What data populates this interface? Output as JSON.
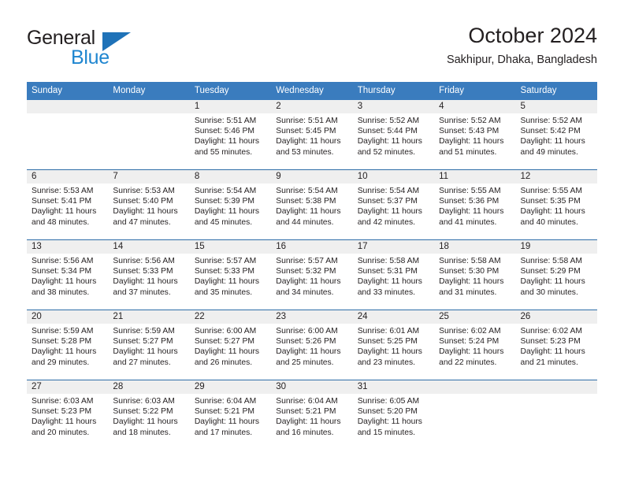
{
  "logo": {
    "word_top": "General",
    "word_bottom": "Blue",
    "triangle_color": "#1f72b8",
    "blue_color": "#1f86d0"
  },
  "header": {
    "title": "October 2024",
    "subtitle": "Sakhipur, Dhaka, Bangladesh"
  },
  "theme": {
    "header_blue": "#3a7cbe",
    "row_divider_blue": "#2e6da8",
    "daynum_band": "#efefef"
  },
  "weekdays": [
    "Sunday",
    "Monday",
    "Tuesday",
    "Wednesday",
    "Thursday",
    "Friday",
    "Saturday"
  ],
  "weeks": [
    [
      {
        "day": "",
        "sunrise": "",
        "sunset": "",
        "daylight1": "",
        "daylight2": ""
      },
      {
        "day": "",
        "sunrise": "",
        "sunset": "",
        "daylight1": "",
        "daylight2": ""
      },
      {
        "day": "1",
        "sunrise": "Sunrise: 5:51 AM",
        "sunset": "Sunset: 5:46 PM",
        "daylight1": "Daylight: 11 hours",
        "daylight2": "and 55 minutes."
      },
      {
        "day": "2",
        "sunrise": "Sunrise: 5:51 AM",
        "sunset": "Sunset: 5:45 PM",
        "daylight1": "Daylight: 11 hours",
        "daylight2": "and 53 minutes."
      },
      {
        "day": "3",
        "sunrise": "Sunrise: 5:52 AM",
        "sunset": "Sunset: 5:44 PM",
        "daylight1": "Daylight: 11 hours",
        "daylight2": "and 52 minutes."
      },
      {
        "day": "4",
        "sunrise": "Sunrise: 5:52 AM",
        "sunset": "Sunset: 5:43 PM",
        "daylight1": "Daylight: 11 hours",
        "daylight2": "and 51 minutes."
      },
      {
        "day": "5",
        "sunrise": "Sunrise: 5:52 AM",
        "sunset": "Sunset: 5:42 PM",
        "daylight1": "Daylight: 11 hours",
        "daylight2": "and 49 minutes."
      }
    ],
    [
      {
        "day": "6",
        "sunrise": "Sunrise: 5:53 AM",
        "sunset": "Sunset: 5:41 PM",
        "daylight1": "Daylight: 11 hours",
        "daylight2": "and 48 minutes."
      },
      {
        "day": "7",
        "sunrise": "Sunrise: 5:53 AM",
        "sunset": "Sunset: 5:40 PM",
        "daylight1": "Daylight: 11 hours",
        "daylight2": "and 47 minutes."
      },
      {
        "day": "8",
        "sunrise": "Sunrise: 5:54 AM",
        "sunset": "Sunset: 5:39 PM",
        "daylight1": "Daylight: 11 hours",
        "daylight2": "and 45 minutes."
      },
      {
        "day": "9",
        "sunrise": "Sunrise: 5:54 AM",
        "sunset": "Sunset: 5:38 PM",
        "daylight1": "Daylight: 11 hours",
        "daylight2": "and 44 minutes."
      },
      {
        "day": "10",
        "sunrise": "Sunrise: 5:54 AM",
        "sunset": "Sunset: 5:37 PM",
        "daylight1": "Daylight: 11 hours",
        "daylight2": "and 42 minutes."
      },
      {
        "day": "11",
        "sunrise": "Sunrise: 5:55 AM",
        "sunset": "Sunset: 5:36 PM",
        "daylight1": "Daylight: 11 hours",
        "daylight2": "and 41 minutes."
      },
      {
        "day": "12",
        "sunrise": "Sunrise: 5:55 AM",
        "sunset": "Sunset: 5:35 PM",
        "daylight1": "Daylight: 11 hours",
        "daylight2": "and 40 minutes."
      }
    ],
    [
      {
        "day": "13",
        "sunrise": "Sunrise: 5:56 AM",
        "sunset": "Sunset: 5:34 PM",
        "daylight1": "Daylight: 11 hours",
        "daylight2": "and 38 minutes."
      },
      {
        "day": "14",
        "sunrise": "Sunrise: 5:56 AM",
        "sunset": "Sunset: 5:33 PM",
        "daylight1": "Daylight: 11 hours",
        "daylight2": "and 37 minutes."
      },
      {
        "day": "15",
        "sunrise": "Sunrise: 5:57 AM",
        "sunset": "Sunset: 5:33 PM",
        "daylight1": "Daylight: 11 hours",
        "daylight2": "and 35 minutes."
      },
      {
        "day": "16",
        "sunrise": "Sunrise: 5:57 AM",
        "sunset": "Sunset: 5:32 PM",
        "daylight1": "Daylight: 11 hours",
        "daylight2": "and 34 minutes."
      },
      {
        "day": "17",
        "sunrise": "Sunrise: 5:58 AM",
        "sunset": "Sunset: 5:31 PM",
        "daylight1": "Daylight: 11 hours",
        "daylight2": "and 33 minutes."
      },
      {
        "day": "18",
        "sunrise": "Sunrise: 5:58 AM",
        "sunset": "Sunset: 5:30 PM",
        "daylight1": "Daylight: 11 hours",
        "daylight2": "and 31 minutes."
      },
      {
        "day": "19",
        "sunrise": "Sunrise: 5:58 AM",
        "sunset": "Sunset: 5:29 PM",
        "daylight1": "Daylight: 11 hours",
        "daylight2": "and 30 minutes."
      }
    ],
    [
      {
        "day": "20",
        "sunrise": "Sunrise: 5:59 AM",
        "sunset": "Sunset: 5:28 PM",
        "daylight1": "Daylight: 11 hours",
        "daylight2": "and 29 minutes."
      },
      {
        "day": "21",
        "sunrise": "Sunrise: 5:59 AM",
        "sunset": "Sunset: 5:27 PM",
        "daylight1": "Daylight: 11 hours",
        "daylight2": "and 27 minutes."
      },
      {
        "day": "22",
        "sunrise": "Sunrise: 6:00 AM",
        "sunset": "Sunset: 5:27 PM",
        "daylight1": "Daylight: 11 hours",
        "daylight2": "and 26 minutes."
      },
      {
        "day": "23",
        "sunrise": "Sunrise: 6:00 AM",
        "sunset": "Sunset: 5:26 PM",
        "daylight1": "Daylight: 11 hours",
        "daylight2": "and 25 minutes."
      },
      {
        "day": "24",
        "sunrise": "Sunrise: 6:01 AM",
        "sunset": "Sunset: 5:25 PM",
        "daylight1": "Daylight: 11 hours",
        "daylight2": "and 23 minutes."
      },
      {
        "day": "25",
        "sunrise": "Sunrise: 6:02 AM",
        "sunset": "Sunset: 5:24 PM",
        "daylight1": "Daylight: 11 hours",
        "daylight2": "and 22 minutes."
      },
      {
        "day": "26",
        "sunrise": "Sunrise: 6:02 AM",
        "sunset": "Sunset: 5:23 PM",
        "daylight1": "Daylight: 11 hours",
        "daylight2": "and 21 minutes."
      }
    ],
    [
      {
        "day": "27",
        "sunrise": "Sunrise: 6:03 AM",
        "sunset": "Sunset: 5:23 PM",
        "daylight1": "Daylight: 11 hours",
        "daylight2": "and 20 minutes."
      },
      {
        "day": "28",
        "sunrise": "Sunrise: 6:03 AM",
        "sunset": "Sunset: 5:22 PM",
        "daylight1": "Daylight: 11 hours",
        "daylight2": "and 18 minutes."
      },
      {
        "day": "29",
        "sunrise": "Sunrise: 6:04 AM",
        "sunset": "Sunset: 5:21 PM",
        "daylight1": "Daylight: 11 hours",
        "daylight2": "and 17 minutes."
      },
      {
        "day": "30",
        "sunrise": "Sunrise: 6:04 AM",
        "sunset": "Sunset: 5:21 PM",
        "daylight1": "Daylight: 11 hours",
        "daylight2": "and 16 minutes."
      },
      {
        "day": "31",
        "sunrise": "Sunrise: 6:05 AM",
        "sunset": "Sunset: 5:20 PM",
        "daylight1": "Daylight: 11 hours",
        "daylight2": "and 15 minutes."
      },
      {
        "day": "",
        "sunrise": "",
        "sunset": "",
        "daylight1": "",
        "daylight2": ""
      },
      {
        "day": "",
        "sunrise": "",
        "sunset": "",
        "daylight1": "",
        "daylight2": ""
      }
    ]
  ]
}
